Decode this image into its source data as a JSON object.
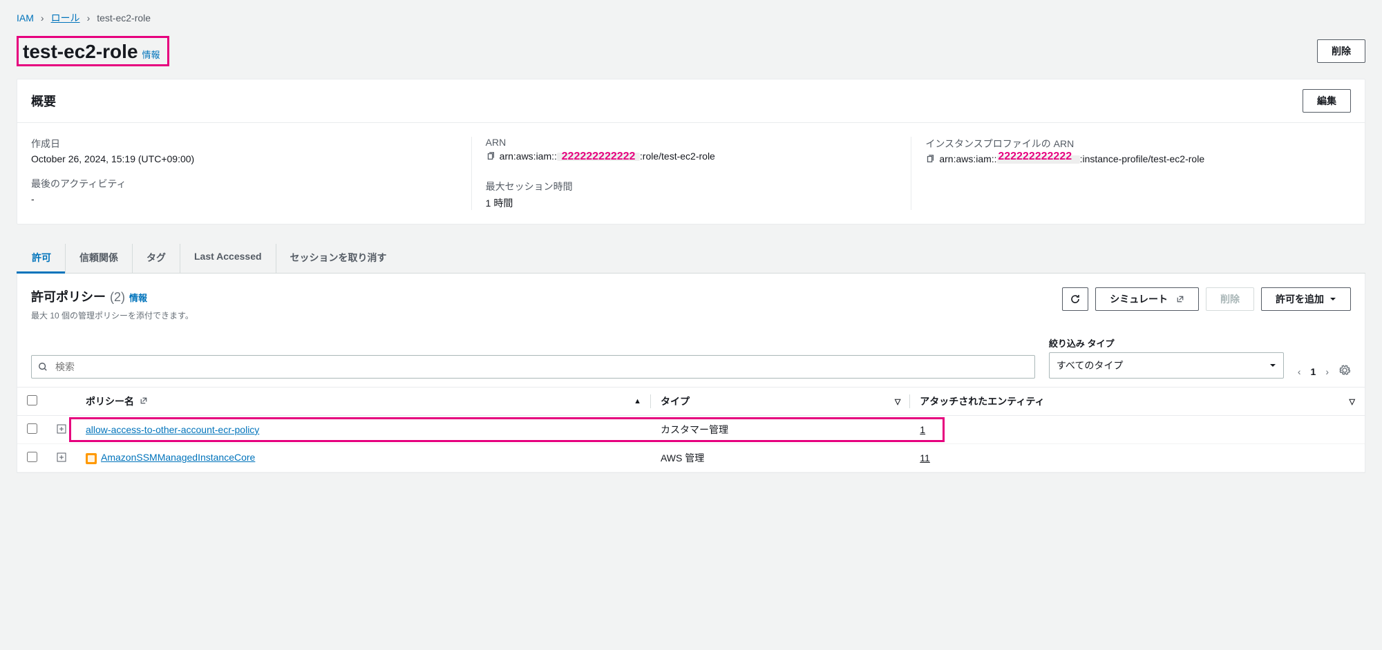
{
  "breadcrumb": {
    "root": "IAM",
    "roles": "ロール",
    "current": "test-ec2-role"
  },
  "header": {
    "title": "test-ec2-role",
    "info": "情報",
    "delete": "削除"
  },
  "summary": {
    "title": "概要",
    "edit": "編集",
    "created_label": "作成日",
    "created_value": "October 26, 2024, 15:19 (UTC+09:00)",
    "last_activity_label": "最後のアクティビティ",
    "last_activity_value": "-",
    "arn_label": "ARN",
    "arn_prefix": "arn:aws:iam::",
    "arn_suffix": ":role/test-ec2-role",
    "arn_annotation": "222222222222",
    "max_session_label": "最大セッション時間",
    "max_session_value": "1 時間",
    "instance_profile_label": "インスタンスプロファイルの ARN",
    "instance_profile_prefix": "arn:aws:iam::",
    "instance_profile_suffix": ":instance-profile/test-ec2-role",
    "instance_profile_annotation": "222222222222"
  },
  "tabs": {
    "permissions": "許可",
    "trust": "信頼関係",
    "tags": "タグ",
    "last_accessed": "Last Accessed",
    "revoke": "セッションを取り消す"
  },
  "policies": {
    "title": "許可ポリシー",
    "count": "(2)",
    "info": "情報",
    "desc": "最大 10 個の管理ポリシーを添付できます。",
    "simulate": "シミュレート",
    "remove": "削除",
    "add": "許可を追加",
    "search_placeholder": "検索",
    "filter_label": "絞り込み タイプ",
    "filter_value": "すべてのタイプ",
    "page": "1",
    "col_name": "ポリシー名",
    "col_type": "タイプ",
    "col_entities": "アタッチされたエンティティ",
    "rows": [
      {
        "name": "allow-access-to-other-account-ecr-policy",
        "type": "カスタマー管理",
        "entities": "1",
        "is_aws": false,
        "highlighted": true
      },
      {
        "name": "AmazonSSMManagedInstanceCore",
        "type": "AWS 管理",
        "entities": "11",
        "is_aws": true,
        "highlighted": false
      }
    ]
  }
}
